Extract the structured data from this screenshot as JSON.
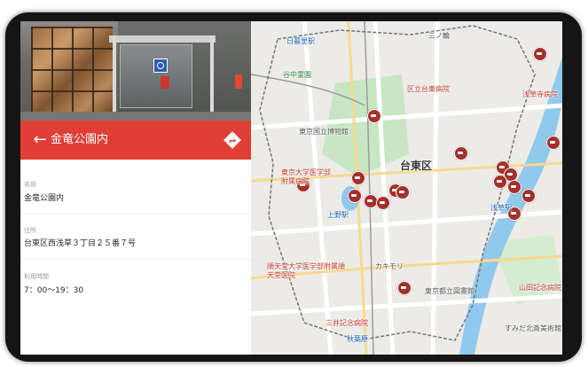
{
  "place": {
    "title": "金竜公園内",
    "fields": [
      {
        "label": "名前",
        "value": "金竜公園内"
      },
      {
        "label": "住所",
        "value": "台東区西浅草３丁目２５番７号"
      },
      {
        "label": "利用時間",
        "value": "7：00～19：30"
      }
    ]
  },
  "colors": {
    "header": "#e03e35",
    "poi": "#a5302b",
    "river": "#8fc9ee",
    "park": "#bfe4c0"
  },
  "icons": {
    "back": "arrow-left-icon",
    "share": "directions-icon",
    "poi": "restroom-pin-icon"
  },
  "map": {
    "labels": [
      {
        "text": "日暮里駅",
        "cls": "blue"
      },
      {
        "text": "谷中霊園",
        "cls": "green"
      },
      {
        "text": "三ノ輪",
        "cls": "gray"
      },
      {
        "text": "東京国立博物館",
        "cls": "gray"
      },
      {
        "text": "区立台東病院",
        "cls": "red"
      },
      {
        "text": "浅草寺病院",
        "cls": "red"
      },
      {
        "text": "台東区",
        "cls": "big"
      },
      {
        "text": "上野駅",
        "cls": "blue"
      },
      {
        "text": "浅草駅",
        "cls": "blue"
      },
      {
        "text": "東京大学医学部附属病院",
        "cls": "red"
      },
      {
        "text": "順天堂大学医学部附属順天堂医院",
        "cls": "red"
      },
      {
        "text": "三井記念病院",
        "cls": "red"
      },
      {
        "text": "山田記念病院",
        "cls": "red"
      },
      {
        "text": "カキモリ",
        "cls": "gray"
      },
      {
        "text": "東京都立図書館",
        "cls": "gray"
      },
      {
        "text": "秋葉原",
        "cls": "blue"
      },
      {
        "text": "すみだ北斎美術館",
        "cls": "gray"
      }
    ]
  }
}
